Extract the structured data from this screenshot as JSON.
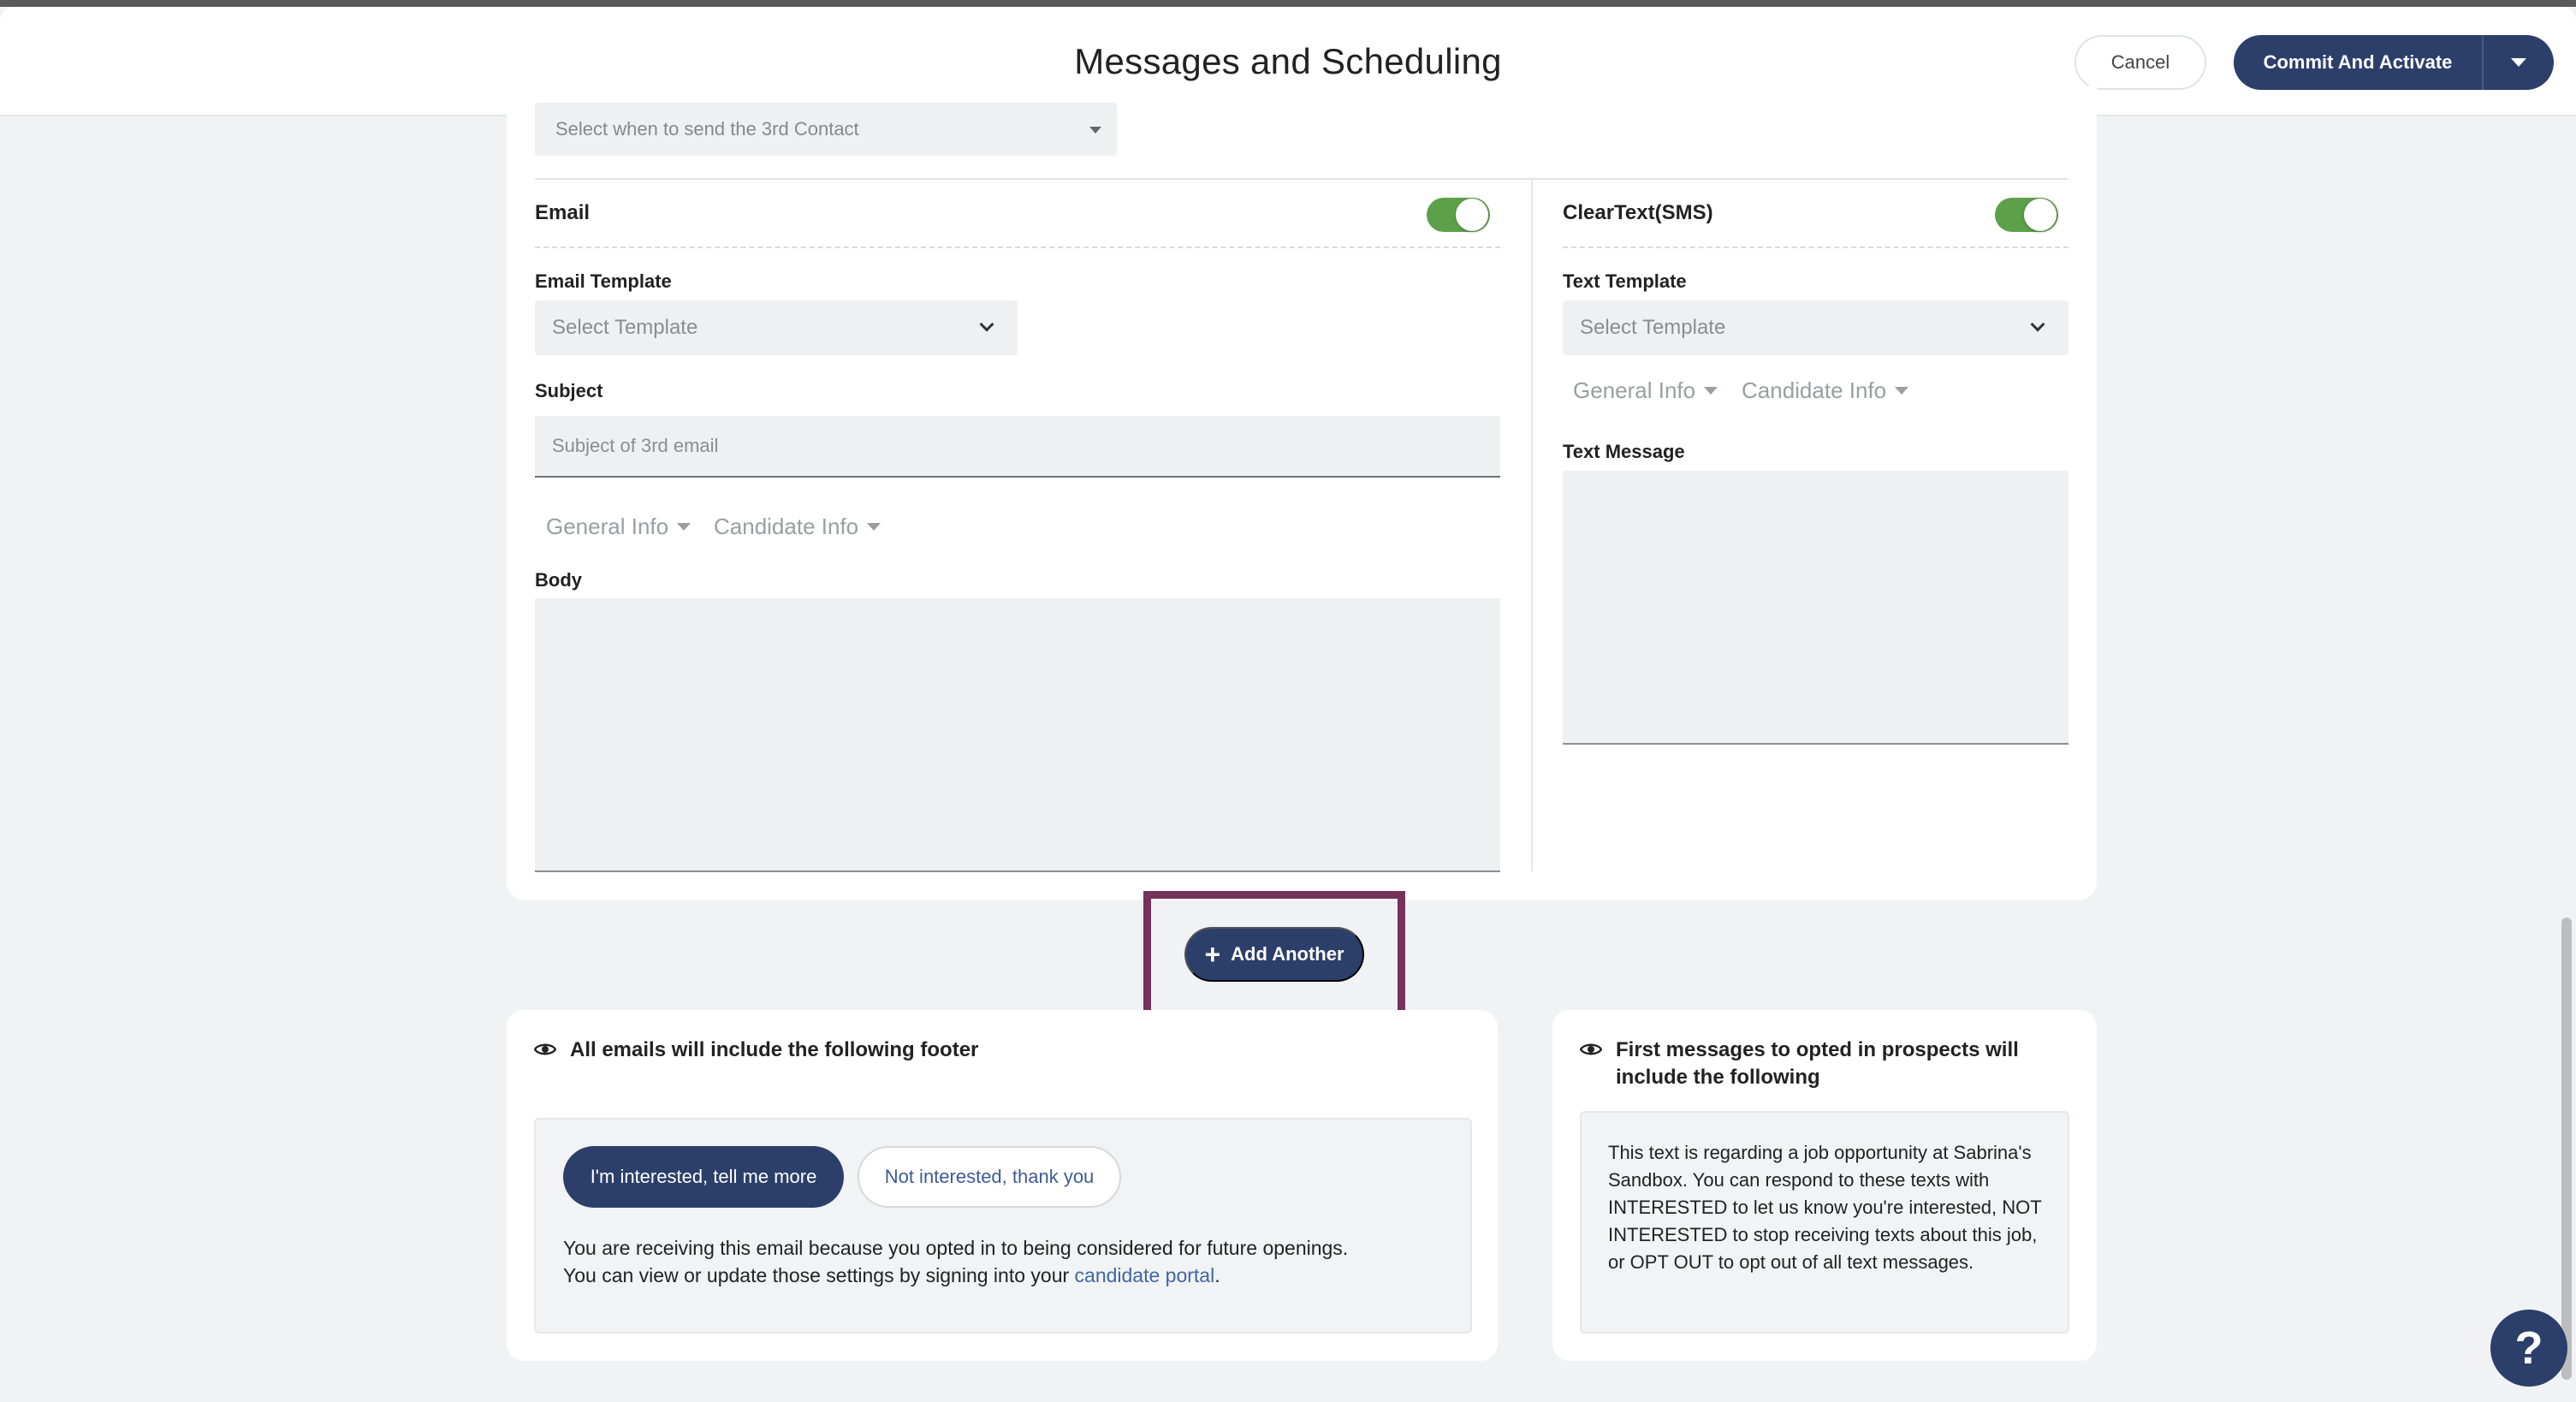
{
  "header": {
    "title": "Messages and Scheduling",
    "cancel_label": "Cancel",
    "commit_label": "Commit And Activate"
  },
  "contact": {
    "when_placeholder": "Select when to send the 3rd Contact"
  },
  "email": {
    "section_label": "Email",
    "enabled": true,
    "template_label": "Email Template",
    "template_placeholder": "Select Template",
    "subject_label": "Subject",
    "subject_placeholder": "Subject of 3rd email",
    "general_info": "General Info",
    "candidate_info": "Candidate Info",
    "body_label": "Body"
  },
  "sms": {
    "section_label": "ClearText(SMS)",
    "enabled": true,
    "template_label": "Text Template",
    "template_placeholder": "Select Template",
    "general_info": "General Info",
    "candidate_info": "Candidate Info",
    "message_label": "Text Message"
  },
  "actions": {
    "add_another_label": "Add Another"
  },
  "email_footer": {
    "title": "All emails will include the following footer",
    "interested_label": "I'm interested, tell me more",
    "not_interested_label": "Not interested, thank you",
    "line1": "You are receiving this email because you opted in to being considered for future openings.",
    "line2_prefix": "You can view or update those settings by signing into your",
    "portal_link": "candidate portal",
    "line2_suffix": "."
  },
  "sms_footer": {
    "title_line1": "First messages to opted in prospects will",
    "title_line2": "include the following",
    "body": "This text is regarding a job opportunity at Sabrina's Sandbox. You can respond to these texts with INTERESTED to let us know you're interested, NOT INTERESTED to stop receiving texts about this job, or OPT OUT to opt out of all text messages."
  },
  "help": {
    "label": "?"
  },
  "colors": {
    "primary": "#2c3f6b",
    "toggle_on": "#5da04a",
    "highlight": "#76325a",
    "link": "#3f66a8"
  }
}
